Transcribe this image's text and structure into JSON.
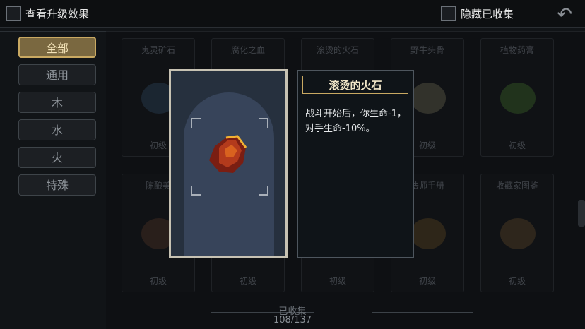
{
  "header": {
    "upgrade_label": "查看升级效果",
    "hide_collected_label": "隐藏已收集"
  },
  "sidebar": {
    "items": [
      {
        "label": "全部",
        "active": true
      },
      {
        "label": "通用",
        "active": false
      },
      {
        "label": "木",
        "active": false
      },
      {
        "label": "水",
        "active": false
      },
      {
        "label": "火",
        "active": false
      },
      {
        "label": "特殊",
        "active": false
      }
    ]
  },
  "grid": {
    "row1": [
      {
        "title": "鬼灵矿石",
        "level": "初级"
      },
      {
        "title": "腐化之血",
        "level": ""
      },
      {
        "title": "滚烫的火石",
        "level": ""
      },
      {
        "title": "野牛头骨",
        "level": "初级"
      },
      {
        "title": "植物药膏",
        "level": "初级"
      }
    ],
    "row2": [
      {
        "title": "陈酿美",
        "level": "初级"
      },
      {
        "title": "",
        "level": "初级"
      },
      {
        "title": "",
        "level": "初级"
      },
      {
        "title": "法师手册",
        "level": "初级"
      },
      {
        "title": "收藏家图鉴",
        "level": "初级"
      }
    ]
  },
  "detail": {
    "name": "滚烫的火石",
    "description": "战斗开始后，你生命-1，对手生命-10%。"
  },
  "footer": {
    "collected_label": "已收集",
    "collected_count": "108/137"
  },
  "colors": {
    "accent_gold": "#c9a962",
    "background": "#111417",
    "panel_blue": "#26303e"
  }
}
